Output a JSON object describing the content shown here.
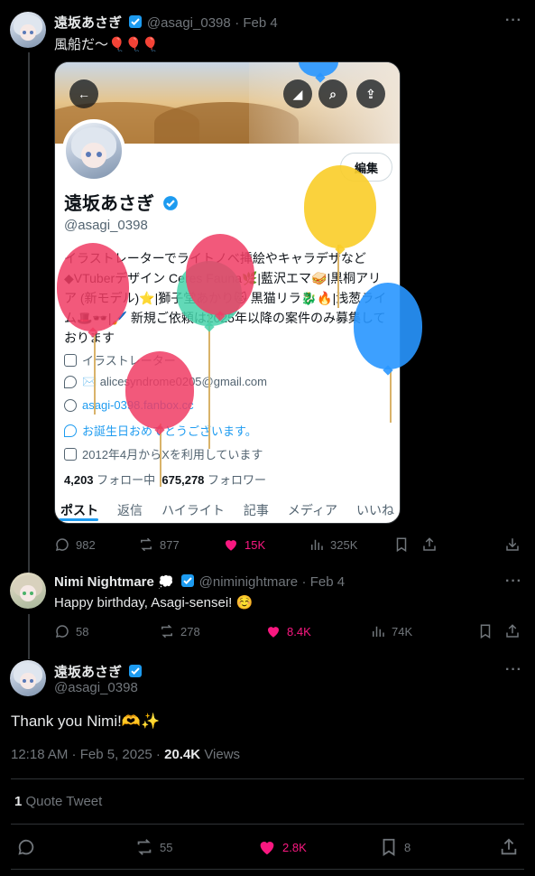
{
  "tweet1": {
    "name": "遠坂あさぎ",
    "handle": "@asagi_0398",
    "date": "· Feb 4",
    "text": "風船だ～🎈🎈🎈",
    "actions": {
      "replies": "982",
      "reposts": "877",
      "likes": "15K",
      "views": "325K"
    }
  },
  "card": {
    "edit_label": "編集",
    "name": "遠坂あさぎ",
    "handle": "@asagi_0398",
    "bio": "イラストレーターでライトノベ挿絵やキャラデザなど◆VTuberデザイン Ceres Fauna🌿|藍沢エマ🥪|黒桐アリア (新モデル)⭐|獅子堂あかり🐱 黒猫リラ🐉🔥|浅葱ライム🎩🕶️|🖌️ 新規ご依頼は2025年以降の案件のみ募集しております",
    "job": "イラストレーター",
    "email": "✉️ alicesyndrome0205@gmail.com",
    "link": "asagi-0398.fanbox.cc",
    "birthday": "お誕生日おめでとうございます。",
    "joined": "2012年4月からXを利用しています",
    "following_count": "4,203",
    "following_label": "フォロー中",
    "followers_count": "675,278",
    "followers_label": "フォロワー",
    "tabs": [
      "ポスト",
      "返信",
      "ハイライト",
      "記事",
      "メディア",
      "いいね"
    ]
  },
  "tweet2": {
    "name": "Nimi Nightmare",
    "handle": "@niminightmare",
    "date": "· Feb 4",
    "text": "Happy birthday, Asagi-sensei! ☺️",
    "actions": {
      "replies": "58",
      "reposts": "278",
      "likes": "8.4K",
      "views": "74K"
    }
  },
  "tweet3": {
    "name": "遠坂あさぎ",
    "handle": "@asagi_0398",
    "text": "Thank you Nimi!🫶✨",
    "timestamp": "12:18 AM · Feb 5, 2025 ·",
    "views_count": "20.4K",
    "views_label": "Views",
    "quote_count": "1",
    "quote_label": "Quote Tweet",
    "actions": {
      "reposts": "55",
      "likes": "2.8K",
      "bookmarks": "8"
    }
  },
  "colors": {
    "like": "#f91880",
    "verified": "#1d9bf0",
    "muted": "#71767b"
  }
}
